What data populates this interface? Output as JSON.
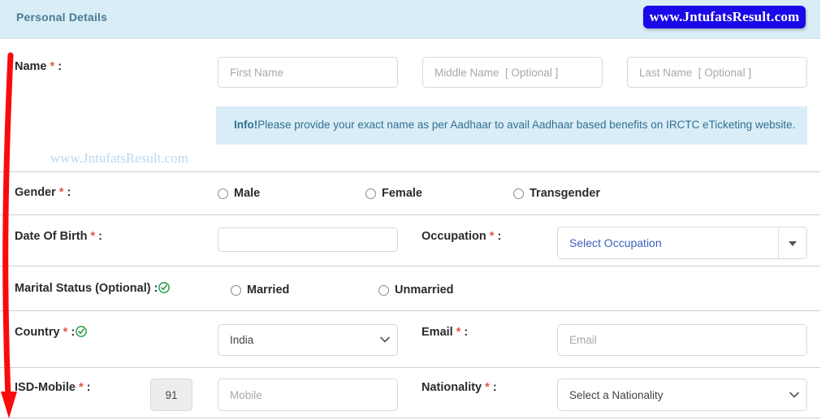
{
  "panel": {
    "title": "Personal Details"
  },
  "watermark": {
    "badge_text": "www.JntufatsResult.com",
    "ghost_text": "www.JntufatsResult.com",
    "badge_bg": "#1a08e8",
    "badge_fg": "#ffffff",
    "ghost_color": "#bcd7ef"
  },
  "colors": {
    "header_bg": "#d9edf7",
    "header_fg": "#4a7b92",
    "required_star": "#e8543f",
    "info_bg": "#d9edf7",
    "info_fg": "#31708f",
    "valid_check": "#1e9a3c",
    "arrow": "#fa0a0a",
    "link_blue": "#3b5fc0"
  },
  "fields": {
    "name": {
      "label": "Name",
      "required_mark": "*",
      "colon": ":",
      "first": {
        "placeholder": "First Name",
        "value": ""
      },
      "middle": {
        "placeholder": "Middle Name  [ Optional ]",
        "value": ""
      },
      "last": {
        "placeholder": "Last Name  [ Optional ]",
        "value": ""
      }
    },
    "info": {
      "strong": "Info!",
      "text": "Please provide your exact name as per Aadhaar to avail Aadhaar based benefits on IRCTC eTicketing website."
    },
    "gender": {
      "label": "Gender",
      "required_mark": "*",
      "colon": ":",
      "options": [
        "Male",
        "Female",
        "Transgender"
      ],
      "selected": ""
    },
    "dob": {
      "label": "Date Of Birth",
      "required_mark": "*",
      "colon": ":",
      "placeholder": "",
      "value": ""
    },
    "occupation": {
      "label": "Occupation",
      "required_mark": "*",
      "colon": ":",
      "selected": "Select Occupation",
      "options": [
        "Select Occupation"
      ]
    },
    "marital": {
      "label": "Marital Status (Optional) :",
      "valid": true,
      "options": [
        "Married",
        "Unmarried"
      ],
      "selected": ""
    },
    "country": {
      "label": "Country",
      "required_mark": "*",
      "colon": ":",
      "valid": true,
      "selected": "India",
      "options": [
        "India"
      ]
    },
    "email": {
      "label": "Email",
      "required_mark": "*",
      "colon": ":",
      "placeholder": "Email",
      "value": ""
    },
    "isd_mobile": {
      "label": "ISD-Mobile",
      "required_mark": "*",
      "colon": ":",
      "isd_code": "91",
      "placeholder": "Mobile",
      "value": ""
    },
    "nationality": {
      "label": "Nationality",
      "required_mark": "*",
      "colon": ":",
      "selected": "Select a Nationality",
      "options": [
        "Select a Nationality"
      ]
    }
  }
}
